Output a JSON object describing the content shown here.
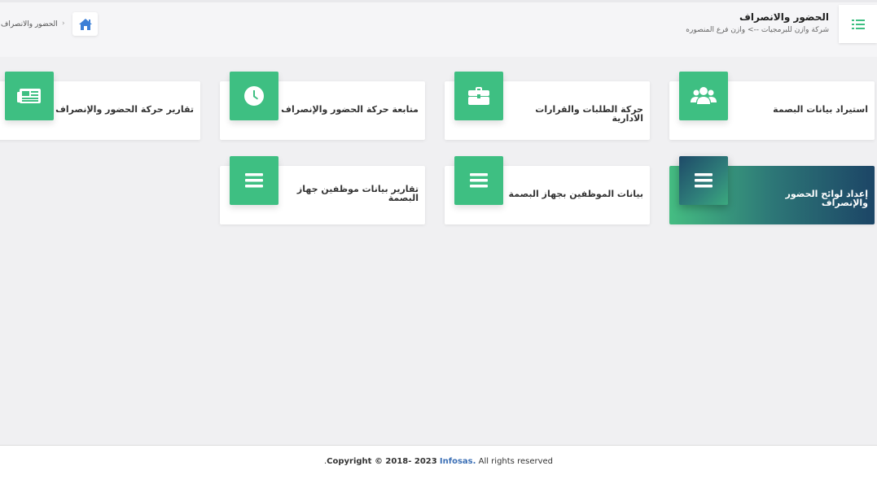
{
  "header": {
    "title": "الحضور والانصراف",
    "subtitle": "شركة وازن للبرمجيات --> وازن فرع المنصوره",
    "menu_icon": "list-icon"
  },
  "breadcrumb": {
    "home_icon": "home-icon",
    "separator": "›",
    "current": "الحضور والانصراف"
  },
  "cards": [
    {
      "label": "استيراد بيانات البصمة",
      "icon": "users-icon"
    },
    {
      "label": "حركة الطلبات والقرارات الادارية",
      "icon": "briefcase-icon"
    },
    {
      "label": "متابعة حركة الحضور والإنصراف",
      "icon": "clock-icon"
    },
    {
      "label": "تقارير حركة الحضور والإنصراف",
      "icon": "newspaper-icon"
    },
    {
      "label": "إعداد لوائح الحضور والإنصراف",
      "icon": "bars-icon",
      "active": true
    },
    {
      "label": "بيانات الموظفين بجهاز البصمة",
      "icon": "bars-icon"
    },
    {
      "label": "تقارير بيانات موظفين جهاز البصمة",
      "icon": "bars-icon"
    }
  ],
  "footer": {
    "copyright": "Copyright © 2018- 2023",
    "brand": "Infosas.",
    "rights": "All rights reserved",
    "prefix": "."
  },
  "colors": {
    "accent": "#3ebf82",
    "active_gradient_dark": "#1c4566",
    "active_gradient_light": "#45bd82",
    "brand_link": "#3b6fb5"
  }
}
